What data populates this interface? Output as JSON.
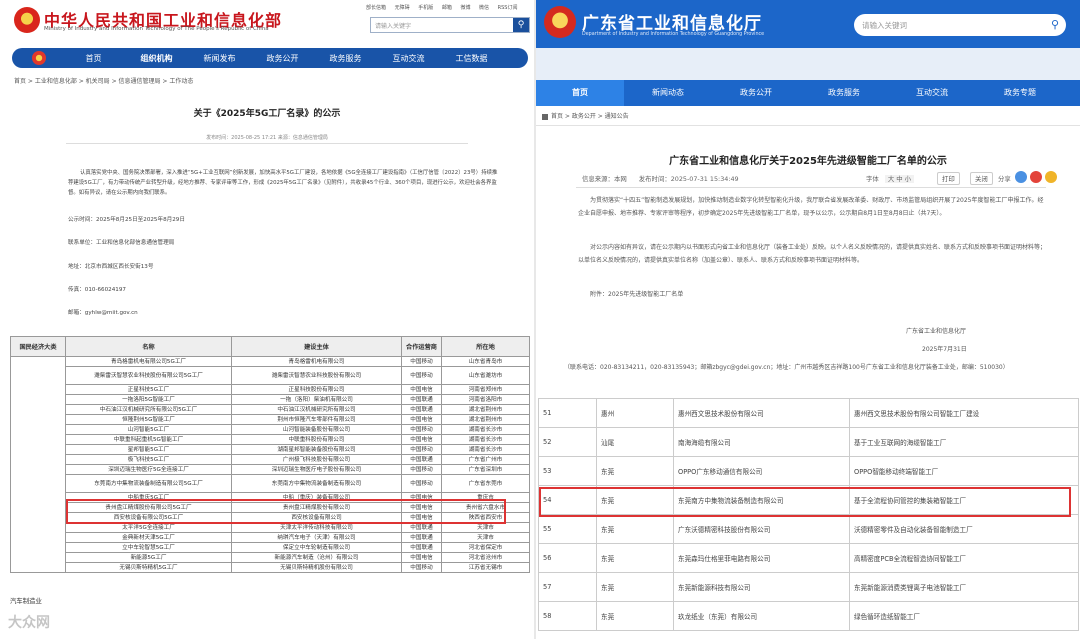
{
  "left": {
    "title": "中华人民共和国工业和信息化部",
    "subtitle": "Ministry of Industry and Information Technology of The People's Republic of China",
    "top_links": [
      "部长信箱",
      "无障碍",
      "手机版",
      "邮箱",
      "微博",
      "微信",
      "RSS订阅"
    ],
    "search_placeholder": "请输入关键字",
    "nav": [
      "首页",
      "组织机构",
      "新闻发布",
      "政务公开",
      "政务服务",
      "互动交流",
      "工信数据"
    ],
    "breadcrumb": "首页 > 工业和信息化部 > 机关司局 > 信息通信管理局 > 工作动态",
    "article_title": "关于《2025年5G工厂名录》的公示",
    "meta": "发布时间：2025-08-25 17:21   来源：信息通信管理局",
    "intro": "认真落实党中央、国务院决策部署，深入推进“5G+工业互联网”创新发展，加快高水平5G工厂建设，各地依据《5G全连接工厂建设指南》（工信厅信管〔2022〕23号）持续推荐建设5G工厂，有力带动传统产业转型升级，经地方推荐、专家评审等工作，形成《2025年5G工厂名录》（见附件），共收录45个行业、360个项目，现进行公示，欢迎社会各界监督。如有异议，请在公示期内向我们联系。",
    "lines": [
      "公示时间：2025年8月25日至2025年8月29日",
      "联系单位：工业和信息化部信息通信管理局",
      "地址：北京市西城区西长安街13号",
      "传真：010-66024197",
      "邮箱：gyhlw@miit.gov.cn"
    ],
    "table_headers": [
      "国民经济大类",
      "名称",
      "建设主体",
      "合作运营商",
      "所在地"
    ],
    "sector": "汽车制造业",
    "watermark": "大众网",
    "rows": [
      [
        "青岛格雷机电有限公司5G工厂",
        "青岛格雷机电有限公司",
        "中国移动",
        "山东省青岛市"
      ],
      [
        "潍柴雷沃智慧农业科技股份有限公司5G工厂",
        "潍柴雷沃智慧农业科技股份有限公司",
        "中国移动",
        "山东省潍坊市"
      ],
      [
        "正星科技5G工厂",
        "正星科技股份有限公司",
        "中国电信",
        "河南省郑州市"
      ],
      [
        "一拖洛阳5G智能工厂",
        "一拖（洛阳）柴油机有限公司",
        "中国联通",
        "河南省洛阳市"
      ],
      [
        "中石油江汉机械研究所有限公司5G工厂",
        "中石油江汉机械研究所有限公司",
        "中国联通",
        "湖北省荆州市"
      ],
      [
        "恒隆荆州5G智能工厂",
        "荆州市恒隆汽车零部件有限公司",
        "中国电信",
        "湖北省荆州市"
      ],
      [
        "山河智能5G工厂",
        "山河智能装备股份有限公司",
        "中国移动",
        "湖南省长沙市"
      ],
      [
        "中联重科起重机5G智能工厂",
        "中联重科股份有限公司",
        "中国电信",
        "湖南省长沙市"
      ],
      [
        "星邦智能5G工厂",
        "湖南星邦智能装备股份有限公司",
        "中国移动",
        "湖南省长沙市"
      ],
      [
        "极飞科技5G工厂",
        "广州极飞科技股份有限公司",
        "中国联通",
        "广东省广州市"
      ],
      [
        "深圳迈瑞生物医疗5G全连接工厂",
        "深圳迈瑞生物医疗电子股份有限公司",
        "中国移动",
        "广东省深圳市"
      ],
      [
        "东莞南方中集物流装备制造有限公司5G工厂",
        "东莞南方中集物流装备制造有限公司",
        "中国移动",
        "广东省东莞市"
      ],
      [
        "中船重庆5G工厂",
        "中船（重庆）装备有限公司",
        "中国电信",
        "重庆市"
      ],
      [
        "贵州盘江精煤股份有限公司5G工厂",
        "贵州盘江精煤股份有限公司",
        "中国电信",
        "贵州省六盘水市"
      ],
      [
        "西安核设备有限公司5G工厂",
        "西安核设备有限公司",
        "中国电信",
        "陕西省西安市"
      ],
      [
        "太平洋5G全连接工厂",
        "天津太平洋传动科技有限公司",
        "中国联通",
        "天津市"
      ],
      [
        "金典新材天津5G工厂",
        "纳琪汽车电子（天津）有限公司",
        "中国联通",
        "天津市"
      ],
      [
        "立中车轮智慧5G工厂",
        "保定立中车轮制造有限公司",
        "中国联通",
        "河北省保定市"
      ],
      [
        "新能源5G工厂",
        "新能源汽车制造（沧州）有限公司",
        "中国电信",
        "河北省沧州市"
      ],
      [
        "无锡贝斯特精机5G工厂",
        "无锡贝斯特精机股份有限公司",
        "中国移动",
        "江苏省无锡市"
      ]
    ]
  },
  "right": {
    "title": "广东省工业和信息化厅",
    "subtitle": "Department of Industry and Information Technology of Guangdong Province",
    "search_placeholder": "请输入关键词",
    "nav": [
      "首页",
      "新闻动态",
      "政务公开",
      "政务服务",
      "互动交流",
      "政务专题"
    ],
    "breadcrumb": "首页 > 政务公开 > 通知公告",
    "article_title": "广东省工业和信息化厅关于2025年先进级智能工厂名单的公示",
    "meta_source": "信息来源：本网",
    "meta_date": "发布时间：2025-07-31 15:34:49",
    "meta_share": "分享",
    "font_label": "字体",
    "font_sizes": "大 中 小",
    "print": "打印",
    "close": "关闭",
    "paragraphs": [
      "为贯彻落实“十四五”智能制造发展规划，加快推动制造业数字化转型智能化升级，我厅联合省发展改革委、财政厅、市场监管局组织开展了2025年度智能工厂申报工作。经企业自愿申报、地市推荐、专家评审等程序，初步确定2025年先进级智能工厂名单，现予以公示，公示期自8月1日至8月8日止（共7天）。",
      "对公示内容如有异议，请在公示期内以书面形式向省工业和信息化厅（装备工业处）反映。以个人名义反映情况的，请提供真实姓名、联系方式和反映事项书面证明材料等；以单位名义反映情况的，请提供真实单位名称（加盖公章）、联系人、联系方式和反映事项书面证明材料等。",
      "附件：2025年先进级智能工厂名单"
    ],
    "sign_org": "广东省工业和信息化厅",
    "sign_date": "2025年7月31日",
    "contact": "（联系电话：020-83134211，020-83135943；邮箱zbgyc@gdei.gov.cn；地址：广州市越秀区吉祥路100号广东省工业和信息化厅装备工业处，邮编：510030）",
    "rows": [
      [
        "51",
        "惠州",
        "惠州西文思技术股份有限公司",
        "惠州西文思技术股份有限公司智能工厂建设"
      ],
      [
        "52",
        "汕尾",
        "南海海缆有限公司",
        "基于工业互联网的海缆智能工厂"
      ],
      [
        "53",
        "东莞",
        "OPPO广东移动通信有限公司",
        "OPPO智能移动终端智能工厂"
      ],
      [
        "54",
        "东莞",
        "东莞南方中集物流装备制造有限公司",
        "基于全流程协同管控的集装箱智能工厂"
      ],
      [
        "55",
        "东莞",
        "广东沃德精密科技股份有限公司",
        "沃德精密零件及自动化装备智能制造工厂"
      ],
      [
        "56",
        "东莞",
        "东莞森玛仕格里菲电路有限公司",
        "高精密度PCB全流程智造协同智能工厂"
      ],
      [
        "57",
        "东莞",
        "东莞新能源科技有限公司",
        "东莞新能源消费类锂离子电池智能工厂"
      ],
      [
        "58",
        "东莞",
        "玖龙纸业（东莞）有限公司",
        "绿色循环造纸智能工厂"
      ]
    ]
  }
}
